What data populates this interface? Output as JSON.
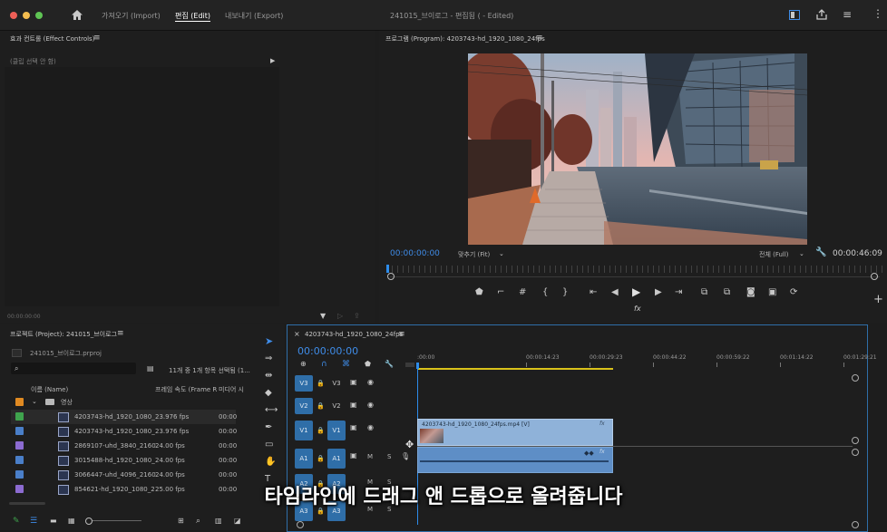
{
  "window": {
    "title": "241015_브이로그 - 편집됨 ( - Edited)",
    "tabs": [
      "가져오기 (Import)",
      "편집 (Edit)",
      "내보내기 (Export)"
    ],
    "active_tab": "편집 (Edit)"
  },
  "effect_controls": {
    "title": "효과 컨트롤 (Effect Controls)",
    "empty_text": "(클립 선택 안 함)",
    "timecode": "00:00:00:00"
  },
  "program": {
    "title": "프로그램 (Program): 4203743-hd_1920_1080_24fps",
    "timecode": "00:00:00:00",
    "zoom": "맞추기 (Fit)",
    "quality": "전체 (Full)",
    "duration": "00:00:46:09"
  },
  "project": {
    "title": "프로젝트 (Project): 241015_브이로그",
    "filename": "241015_브이로그.prproj",
    "selection_info": "11개 중 1개 항목 선택됨 (1...",
    "col_name": "이름 (Name)",
    "col_fps": "프레임 속도 (Frame R",
    "col_media": "미디어 시",
    "folder": "영상",
    "items": [
      {
        "name": "4203743-hd_1920_1080_",
        "fps": "23.976 fps",
        "start": "00:00",
        "color": "#3fa34d",
        "selected": true
      },
      {
        "name": "4203743-hd_1920_1080_",
        "fps": "23.976 fps",
        "start": "00:00",
        "color": "#4a7fc9",
        "selected": false
      },
      {
        "name": "2869107-uhd_3840_2160",
        "fps": "24.00 fps",
        "start": "00:00",
        "color": "#8c6bd1",
        "selected": false
      },
      {
        "name": "3015488-hd_1920_1080_",
        "fps": "24.00 fps",
        "start": "00:00",
        "color": "#4a7fc9",
        "selected": false
      },
      {
        "name": "3066447-uhd_4096_2160",
        "fps": "24.00 fps",
        "start": "00:00",
        "color": "#4a7fc9",
        "selected": false
      },
      {
        "name": "854621-hd_1920_1080_2",
        "fps": "25.00 fps",
        "start": "00:00",
        "color": "#8c6bd1",
        "selected": false
      }
    ]
  },
  "timeline": {
    "sequence_tab": "4203743-hd_1920_1080_24fps",
    "timecode": "00:00:00:00",
    "ruler": [
      ":00:00",
      "00:00:14:23",
      "00:00:29:23",
      "00:00:44:22",
      "00:00:59:22",
      "00:01:14:22",
      "00:01:29:21"
    ],
    "video_tracks": [
      "V3",
      "V2",
      "V1"
    ],
    "audio_tracks": [
      "A1",
      "A2",
      "A3"
    ],
    "clip_label": "4203743-hd_1920_1080_24fps.mp4 [V]",
    "fx_label": "fx",
    "track_m": "M",
    "track_s": "S"
  },
  "subtitle": "타임라인에 드래그 앤 드롭으로 올려줍니다",
  "icons": {
    "home": "home-icon",
    "menu": "≡",
    "fx": "fx"
  },
  "colors": {
    "accent": "#3f8ce8",
    "playhead": "#2d8ceb",
    "video_clip": "#8fb2d9",
    "audio_clip": "#5e8ec6",
    "work_area": "#d9c21a"
  }
}
